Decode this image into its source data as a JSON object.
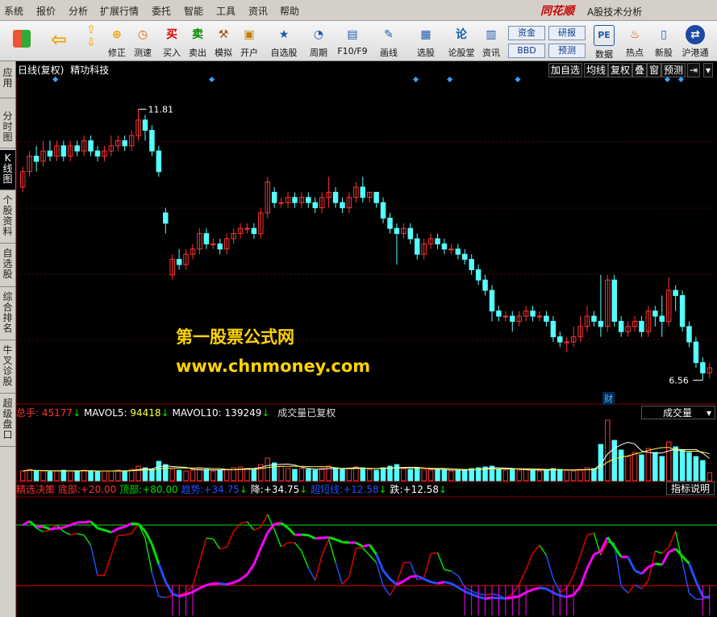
{
  "menu": [
    "系统",
    "报价",
    "分析",
    "扩展行情",
    "委托",
    "智能",
    "工具",
    "资讯",
    "帮助"
  ],
  "brand": "同花顺",
  "app_title": "A股技术分析",
  "toolbar": {
    "buttons": [
      {
        "label": "修正",
        "icon": "⊕"
      },
      {
        "label": "测速",
        "icon": "◷"
      },
      {
        "label": "买入",
        "icon": "买"
      },
      {
        "label": "卖出",
        "icon": "卖"
      },
      {
        "label": "模拟",
        "icon": "⚒"
      },
      {
        "label": "开户",
        "icon": "▣"
      },
      {
        "label": "自选股",
        "icon": "★"
      },
      {
        "label": "周期",
        "icon": "◔"
      },
      {
        "label": "F10/F9",
        "icon": "▤"
      },
      {
        "label": "画线",
        "icon": "✎"
      },
      {
        "label": "选股",
        "icon": "▦"
      },
      {
        "label": "论股堂",
        "icon": "论"
      },
      {
        "label": "资讯",
        "icon": "▥"
      },
      {
        "label": "数据",
        "icon": "PE"
      },
      {
        "label": "热点",
        "icon": "♨"
      },
      {
        "label": "新股",
        "icon": "▯"
      },
      {
        "label": "沪港通",
        "icon": "⇄"
      }
    ],
    "box_labels": [
      "资金",
      "BBD",
      "研报",
      "预测"
    ]
  },
  "side_tabs": [
    "应用",
    "分时图",
    "K线图",
    "个股资料",
    "自选股",
    "综合排名",
    "牛叉诊股",
    "超级盘口"
  ],
  "chart_header": {
    "period": "日线(复权)",
    "stock_name": "精功科技"
  },
  "header_buttons": [
    "加自选",
    "均线",
    "复权",
    "叠",
    "窗",
    "预测",
    "⇥"
  ],
  "price_labels": {
    "high": "11.81",
    "low": "6.56",
    "event_tag": "财"
  },
  "watermark": {
    "line1": "第一股票公式网",
    "line2": "www.chnmoney.com"
  },
  "volume_panel": {
    "total_label": "总手:",
    "total": "45177",
    "ma5_label": "MAVOL5:",
    "ma5": "94418",
    "ma10_label": "MAVOL10:",
    "ma10": "139249",
    "note": "成交量已复权",
    "dropdown": "成交量"
  },
  "indicator_panel": {
    "name": "精选决策",
    "bottom_label": "底部:",
    "bottom": "+20.00",
    "top_label": "顶部:",
    "top": "+80.00",
    "trend_label": "趋势:",
    "trend": "+34.75",
    "down_label": "降:",
    "down": "+34.75",
    "super_label": "超短线:",
    "super": "+12.58",
    "fall_label": "跌:",
    "fall": "+12.58",
    "help": "指标说明"
  },
  "colors": {
    "up": "#ff3232",
    "down": "#54ffff",
    "pink": "#ff00ff",
    "green": "#00e000",
    "blue": "#2050ff",
    "red": "#e00000"
  },
  "chart_data": {
    "type": "candlestick",
    "y_price_range": [
      6.3,
      12.3
    ],
    "candles": [
      [
        10.3,
        10.6,
        10.2,
        10.7
      ],
      [
        10.6,
        10.9,
        10.5,
        11.0
      ],
      [
        10.9,
        10.8,
        10.6,
        11.1
      ],
      [
        10.8,
        11.0,
        10.7,
        11.2
      ],
      [
        11.0,
        10.9,
        10.8,
        11.2
      ],
      [
        10.9,
        11.1,
        10.8,
        11.2
      ],
      [
        11.1,
        10.9,
        10.8,
        11.2
      ],
      [
        10.9,
        11.1,
        10.8,
        11.2
      ],
      [
        11.1,
        11.0,
        10.9,
        11.2
      ],
      [
        11.0,
        11.2,
        10.9,
        11.3
      ],
      [
        11.2,
        11.0,
        10.9,
        11.3
      ],
      [
        11.0,
        10.9,
        10.8,
        11.1
      ],
      [
        10.9,
        11.0,
        10.8,
        11.1
      ],
      [
        11.0,
        11.1,
        10.9,
        11.3
      ],
      [
        11.1,
        11.2,
        11.0,
        11.3
      ],
      [
        11.2,
        11.1,
        11.0,
        11.3
      ],
      [
        11.1,
        11.3,
        11.0,
        11.4
      ],
      [
        11.3,
        11.6,
        11.2,
        11.81
      ],
      [
        11.6,
        11.4,
        11.2,
        11.7
      ],
      [
        11.4,
        11.0,
        10.9,
        11.5
      ],
      [
        11.0,
        10.6,
        10.5,
        11.1
      ],
      [
        9.8,
        9.6,
        9.4,
        9.9
      ],
      [
        8.6,
        8.9,
        8.5,
        9.0
      ],
      [
        8.9,
        8.8,
        8.7,
        9.1
      ],
      [
        8.8,
        9.0,
        8.7,
        9.1
      ],
      [
        9.0,
        9.1,
        8.9,
        9.2
      ],
      [
        9.1,
        9.4,
        9.0,
        9.5
      ],
      [
        9.4,
        9.2,
        9.1,
        9.5
      ],
      [
        9.2,
        9.2,
        9.1,
        9.3
      ],
      [
        9.2,
        9.1,
        9.0,
        9.3
      ],
      [
        9.1,
        9.3,
        9.0,
        9.4
      ],
      [
        9.3,
        9.4,
        9.2,
        9.5
      ],
      [
        9.4,
        9.5,
        9.3,
        9.6
      ],
      [
        9.5,
        9.5,
        9.4,
        9.6
      ],
      [
        9.5,
        9.4,
        9.3,
        9.6
      ],
      [
        9.4,
        9.8,
        9.3,
        9.9
      ],
      [
        9.8,
        10.4,
        9.7,
        10.5
      ],
      [
        10.2,
        10.0,
        9.9,
        10.3
      ],
      [
        10.0,
        10.0,
        9.9,
        10.1
      ],
      [
        10.0,
        10.1,
        9.9,
        10.2
      ],
      [
        10.1,
        10.0,
        9.9,
        10.2
      ],
      [
        10.0,
        10.1,
        9.9,
        10.2
      ],
      [
        10.1,
        10.0,
        9.9,
        10.2
      ],
      [
        10.0,
        9.9,
        9.8,
        10.1
      ],
      [
        9.9,
        10.1,
        9.8,
        10.2
      ],
      [
        10.1,
        10.2,
        9.9,
        10.5
      ],
      [
        10.2,
        10.0,
        9.9,
        10.3
      ],
      [
        10.0,
        9.9,
        9.8,
        10.1
      ],
      [
        9.9,
        10.1,
        9.8,
        10.2
      ],
      [
        10.1,
        10.3,
        10.0,
        10.4
      ],
      [
        10.3,
        10.1,
        10.0,
        10.5
      ],
      [
        10.1,
        10.2,
        10.0,
        10.2
      ],
      [
        10.2,
        10.0,
        9.9,
        10.2
      ],
      [
        10.0,
        9.7,
        9.6,
        10.1
      ],
      [
        9.7,
        9.5,
        9.4,
        9.8
      ],
      [
        9.5,
        9.4,
        8.8,
        9.6
      ],
      [
        9.4,
        9.5,
        9.3,
        9.6
      ],
      [
        9.5,
        9.3,
        9.2,
        9.6
      ],
      [
        9.3,
        9.0,
        8.9,
        9.4
      ],
      [
        9.0,
        9.2,
        8.9,
        9.3
      ],
      [
        9.2,
        9.3,
        9.1,
        9.4
      ],
      [
        9.3,
        9.2,
        9.1,
        9.4
      ],
      [
        9.2,
        9.1,
        9.0,
        9.3
      ],
      [
        9.1,
        9.1,
        9.0,
        9.2
      ],
      [
        9.1,
        9.0,
        8.9,
        9.2
      ],
      [
        9.0,
        8.9,
        8.8,
        9.1
      ],
      [
        8.9,
        8.7,
        8.6,
        9.0
      ],
      [
        8.7,
        8.5,
        8.4,
        8.8
      ],
      [
        8.5,
        8.3,
        8.2,
        8.6
      ],
      [
        8.3,
        7.9,
        7.7,
        8.4
      ],
      [
        7.9,
        7.8,
        7.7,
        8.0
      ],
      [
        7.8,
        7.8,
        7.7,
        7.9
      ],
      [
        7.8,
        7.7,
        7.5,
        7.9
      ],
      [
        7.7,
        7.8,
        7.6,
        7.9
      ],
      [
        7.8,
        7.9,
        7.7,
        8.0
      ],
      [
        7.9,
        7.8,
        7.7,
        8.0
      ],
      [
        7.8,
        7.8,
        7.7,
        7.9
      ],
      [
        7.8,
        7.7,
        7.6,
        7.9
      ],
      [
        7.7,
        7.4,
        7.3,
        7.8
      ],
      [
        7.4,
        7.3,
        7.2,
        7.5
      ],
      [
        7.3,
        7.3,
        7.1,
        7.4
      ],
      [
        7.3,
        7.4,
        7.2,
        7.6
      ],
      [
        7.4,
        7.6,
        7.3,
        7.8
      ],
      [
        7.6,
        7.8,
        7.5,
        8.0
      ],
      [
        7.8,
        7.7,
        7.6,
        7.9
      ],
      [
        7.7,
        7.6,
        7.4,
        8.6
      ],
      [
        7.6,
        8.5,
        7.5,
        8.6
      ],
      [
        8.5,
        7.7,
        7.6,
        8.6
      ],
      [
        7.7,
        7.5,
        7.4,
        7.8
      ],
      [
        7.5,
        7.6,
        7.4,
        7.7
      ],
      [
        7.6,
        7.7,
        7.5,
        7.8
      ],
      [
        7.7,
        7.5,
        7.4,
        7.8
      ],
      [
        7.5,
        7.9,
        7.4,
        8.0
      ],
      [
        7.9,
        7.8,
        7.6,
        8.0
      ],
      [
        7.8,
        7.7,
        7.4,
        8.2
      ],
      [
        7.7,
        8.3,
        7.6,
        8.55
      ],
      [
        8.3,
        8.2,
        7.9,
        8.4
      ],
      [
        8.2,
        7.6,
        7.5,
        8.3
      ],
      [
        7.6,
        7.3,
        7.2,
        7.7
      ],
      [
        7.3,
        6.9,
        6.8,
        7.4
      ],
      [
        6.9,
        6.7,
        6.56,
        7.0
      ],
      [
        6.7,
        6.8,
        6.6,
        6.9
      ]
    ],
    "volumes": [
      12,
      14,
      12,
      12,
      11,
      12,
      13,
      12,
      12,
      13,
      12,
      11,
      12,
      12,
      13,
      12,
      14,
      18,
      16,
      14,
      24,
      20,
      14,
      13,
      12,
      13,
      15,
      14,
      12,
      13,
      14,
      16,
      17,
      15,
      14,
      20,
      28,
      22,
      18,
      15,
      14,
      15,
      14,
      13,
      15,
      18,
      16,
      14,
      15,
      17,
      16,
      14,
      13,
      16,
      18,
      20,
      15,
      14,
      16,
      14,
      13,
      14,
      13,
      12,
      13,
      14,
      15,
      16,
      17,
      18,
      14,
      13,
      14,
      13,
      14,
      13,
      12,
      13,
      15,
      14,
      13,
      12,
      14,
      16,
      15,
      45,
      75,
      50,
      38,
      30,
      35,
      32,
      40,
      35,
      30,
      48,
      42,
      38,
      35,
      30,
      25,
      10
    ],
    "ma5_volume_label": "MAVOL5",
    "ma10_volume_label": "MAVOL10"
  }
}
